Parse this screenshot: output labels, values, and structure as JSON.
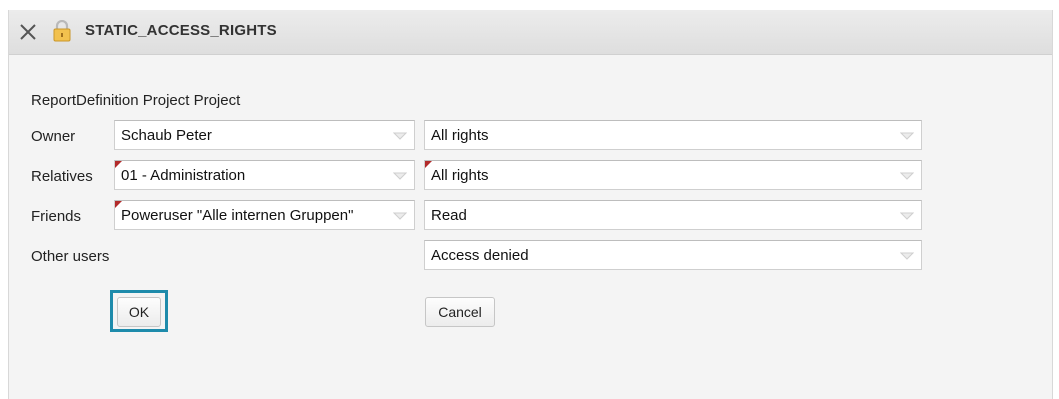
{
  "titlebar": {
    "title": "STATIC_ACCESS_RIGHTS",
    "close_icon": "close-icon",
    "lock_icon": "lock-icon"
  },
  "subject": "ReportDefinition Project Project",
  "rows": {
    "owner": {
      "label": "Owner",
      "member": "Schaub Peter",
      "rights": "All rights"
    },
    "relatives": {
      "label": "Relatives",
      "member": "01 - Administration",
      "rights": "All rights"
    },
    "friends": {
      "label": "Friends",
      "member": "Poweruser \"Alle internen Gruppen\"",
      "rights": "Read"
    },
    "other": {
      "label": "Other users",
      "rights": "Access denied"
    }
  },
  "buttons": {
    "ok": "OK",
    "cancel": "Cancel"
  },
  "colors": {
    "focus_ring": "#1e8bab",
    "modified_marker": "#b22a2a",
    "titlebar": "#e4e4e4"
  }
}
